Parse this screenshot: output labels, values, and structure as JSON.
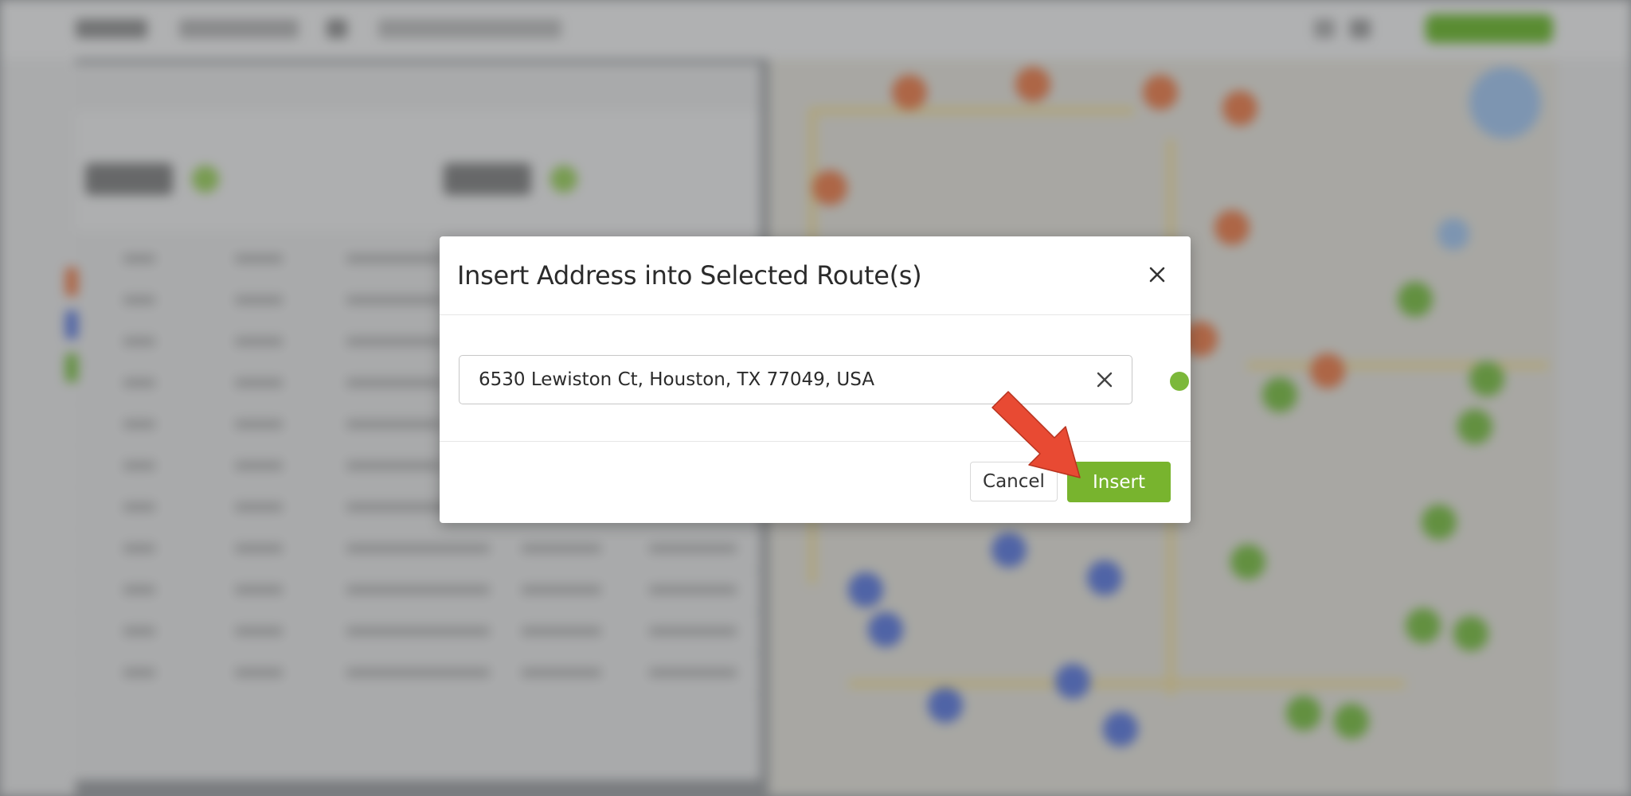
{
  "modal": {
    "title": "Insert Address into Selected Route(s)",
    "address_value": "6530 Lewiston Ct, Houston, TX 77049, USA",
    "address_placeholder": "",
    "route_color": "#7cb83a",
    "cancel_label": "Cancel",
    "insert_label": "Insert",
    "insert_color": "#78b42e"
  },
  "icons": {
    "close": "close-icon",
    "clear": "clear-icon",
    "annotation": "arrow-annotation-icon"
  },
  "colors": {
    "annotation_arrow": "#e84a33"
  }
}
